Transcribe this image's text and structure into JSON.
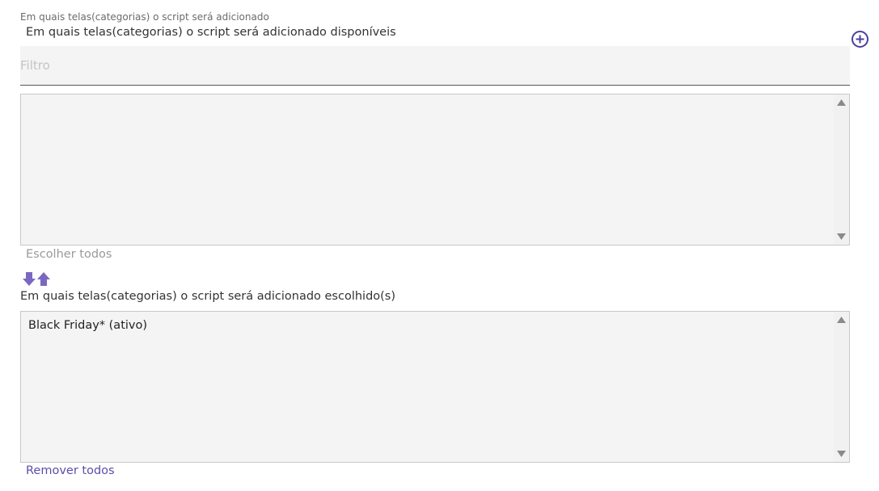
{
  "field": {
    "label": "Em quais telas(categorias) o script será adicionado"
  },
  "available": {
    "label": "Em quais telas(categorias) o script será adicionado disponíveis",
    "filter_placeholder": "Filtro",
    "filter_value": "",
    "items": [],
    "choose_all_label": "Escolher todos"
  },
  "selected": {
    "label": "Em quais telas(categorias) o script será adicionado escolhido(s)",
    "items": [
      "Black Friday* (ativo)"
    ],
    "remove_all_label": "Remover todos"
  },
  "icons": {
    "add": "plus-circle-icon",
    "move_down": "arrow-down-icon",
    "move_up": "arrow-up-icon",
    "scroll_up": "triangle-up-icon",
    "scroll_down": "triangle-down-icon"
  },
  "colors": {
    "accent": "#4b3f9e",
    "arrow": "#7a68c0",
    "link_disabled": "#9a9a9a",
    "link_active": "#5a4fa8",
    "list_bg": "#f4f4f4"
  }
}
